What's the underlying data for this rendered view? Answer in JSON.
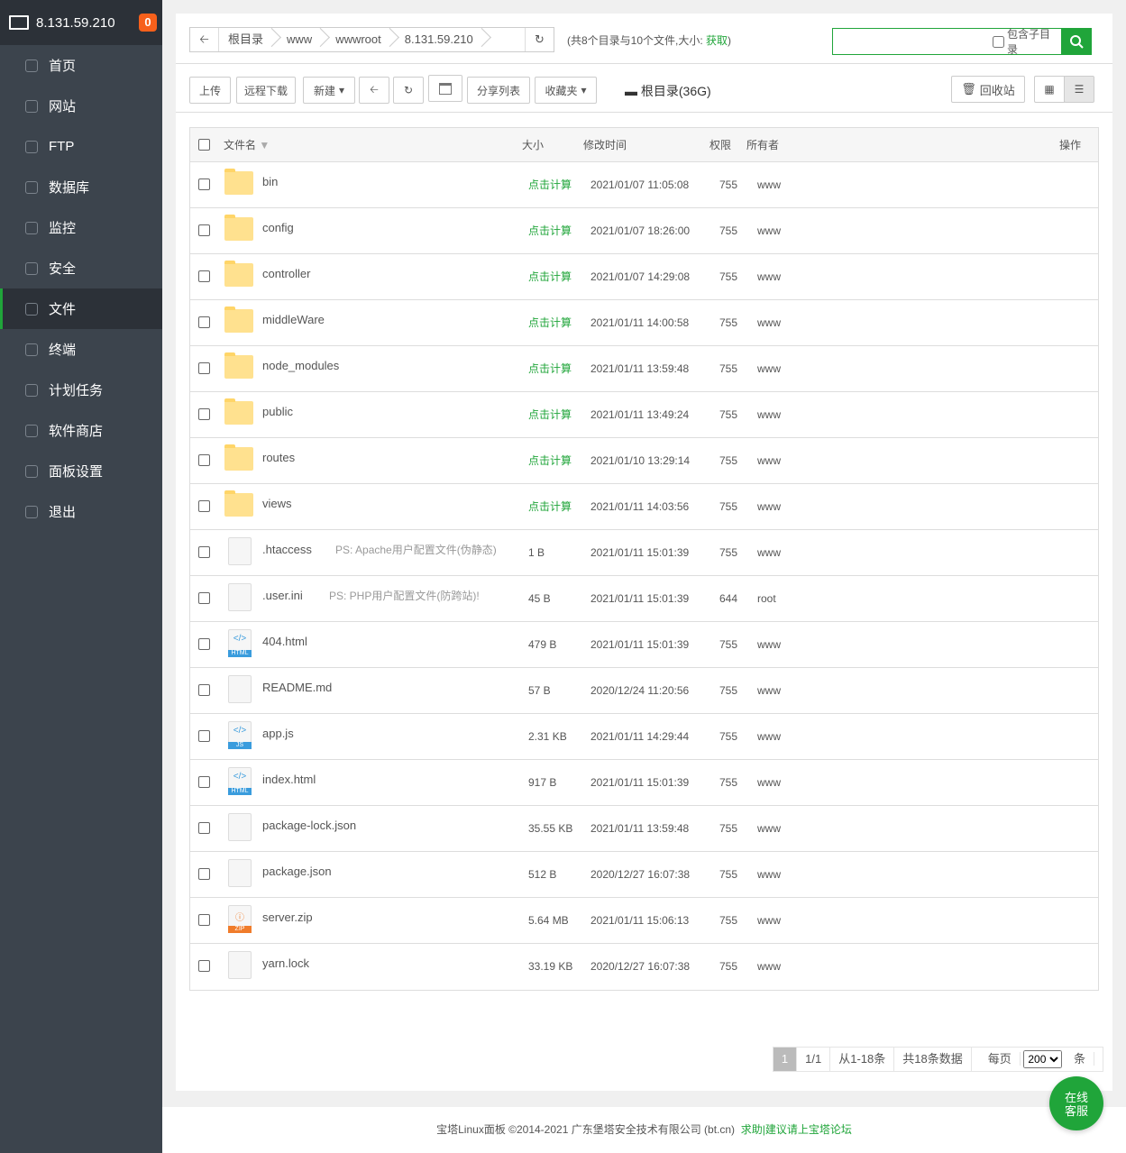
{
  "sidebar": {
    "server_ip": "8.131.59.210",
    "badge": "0",
    "items": [
      {
        "label": "首页",
        "icon": "home-icon"
      },
      {
        "label": "网站",
        "icon": "globe-icon"
      },
      {
        "label": "FTP",
        "icon": "ftp-icon"
      },
      {
        "label": "数据库",
        "icon": "database-icon"
      },
      {
        "label": "监控",
        "icon": "monitor-icon"
      },
      {
        "label": "安全",
        "icon": "shield-icon"
      },
      {
        "label": "文件",
        "icon": "folder-icon",
        "active": true
      },
      {
        "label": "终端",
        "icon": "terminal-icon"
      },
      {
        "label": "计划任务",
        "icon": "calendar-icon"
      },
      {
        "label": "软件商店",
        "icon": "apps-icon"
      },
      {
        "label": "面板设置",
        "icon": "gear-icon"
      },
      {
        "label": "退出",
        "icon": "logout-icon"
      }
    ]
  },
  "breadcrumb": [
    "根目录",
    "www",
    "wwwroot",
    "8.131.59.210"
  ],
  "summary": {
    "text": "(共8个目录与10个文件,大小: ",
    "link": "获取",
    "close": ")"
  },
  "search": {
    "value": "",
    "include_sub": "包含子目录"
  },
  "toolbar": {
    "upload": "上传",
    "remote_download": "远程下载",
    "new": "新建",
    "share_list": "分享列表",
    "favorites": "收藏夹",
    "disk": "根目录(36G)",
    "recycle": "回收站"
  },
  "table": {
    "headers": {
      "name": "文件名",
      "size": "大小",
      "mtime": "修改时间",
      "perm": "权限",
      "owner": "所有者",
      "ops": "操作"
    },
    "rows": [
      {
        "type": "folder",
        "name": "bin",
        "size": "点击计算",
        "mtime": "2021/01/07 11:05:08",
        "perm": "755",
        "owner": "www"
      },
      {
        "type": "folder",
        "name": "config",
        "size": "点击计算",
        "mtime": "2021/01/07 18:26:00",
        "perm": "755",
        "owner": "www"
      },
      {
        "type": "folder",
        "name": "controller",
        "size": "点击计算",
        "mtime": "2021/01/07 14:29:08",
        "perm": "755",
        "owner": "www"
      },
      {
        "type": "folder",
        "name": "middleWare",
        "size": "点击计算",
        "mtime": "2021/01/11 14:00:58",
        "perm": "755",
        "owner": "www"
      },
      {
        "type": "folder",
        "name": "node_modules",
        "size": "点击计算",
        "mtime": "2021/01/11 13:59:48",
        "perm": "755",
        "owner": "www"
      },
      {
        "type": "folder",
        "name": "public",
        "size": "点击计算",
        "mtime": "2021/01/11 13:49:24",
        "perm": "755",
        "owner": "www"
      },
      {
        "type": "folder",
        "name": "routes",
        "size": "点击计算",
        "mtime": "2021/01/10 13:29:14",
        "perm": "755",
        "owner": "www"
      },
      {
        "type": "folder",
        "name": "views",
        "size": "点击计算",
        "mtime": "2021/01/11 14:03:56",
        "perm": "755",
        "owner": "www"
      },
      {
        "type": "file",
        "name": ".htaccess",
        "note": "PS: Apache用户配置文件(伪静态)",
        "size": "1 B",
        "mtime": "2021/01/11 15:01:39",
        "perm": "755",
        "owner": "www"
      },
      {
        "type": "file",
        "name": ".user.ini",
        "note": "PS: PHP用户配置文件(防跨站)!",
        "size": "45 B",
        "mtime": "2021/01/11 15:01:39",
        "perm": "644",
        "owner": "root"
      },
      {
        "type": "html",
        "name": "404.html",
        "size": "479 B",
        "mtime": "2021/01/11 15:01:39",
        "perm": "755",
        "owner": "www"
      },
      {
        "type": "file",
        "name": "README.md",
        "size": "57 B",
        "mtime": "2020/12/24 11:20:56",
        "perm": "755",
        "owner": "www"
      },
      {
        "type": "js",
        "name": "app.js",
        "size": "2.31 KB",
        "mtime": "2021/01/11 14:29:44",
        "perm": "755",
        "owner": "www"
      },
      {
        "type": "html",
        "name": "index.html",
        "size": "917 B",
        "mtime": "2021/01/11 15:01:39",
        "perm": "755",
        "owner": "www"
      },
      {
        "type": "file",
        "name": "package-lock.json",
        "size": "35.55 KB",
        "mtime": "2021/01/11 13:59:48",
        "perm": "755",
        "owner": "www"
      },
      {
        "type": "file",
        "name": "package.json",
        "size": "512 B",
        "mtime": "2020/12/27 16:07:38",
        "perm": "755",
        "owner": "www"
      },
      {
        "type": "zip",
        "name": "server.zip",
        "size": "5.64 MB",
        "mtime": "2021/01/11 15:06:13",
        "perm": "755",
        "owner": "www"
      },
      {
        "type": "file",
        "name": "yarn.lock",
        "size": "33.19 KB",
        "mtime": "2020/12/27 16:07:38",
        "perm": "755",
        "owner": "www"
      }
    ]
  },
  "pager": {
    "current": "1",
    "pages": "1/1",
    "range": "从1-18条",
    "total": "共18条数据",
    "per_page_label": "每页",
    "per_page": "200",
    "unit": "条"
  },
  "footer": {
    "text": "宝塔Linux面板 ©2014-2021 广东堡塔安全技术有限公司 (bt.cn)",
    "link": "求助|建议请上宝塔论坛"
  },
  "help": {
    "line1": "在线",
    "line2": "客服"
  },
  "colors": {
    "accent": "#20a53a",
    "sidebar": "#3c444d",
    "badge": "#f7601b",
    "folder": "#ffe18f"
  }
}
